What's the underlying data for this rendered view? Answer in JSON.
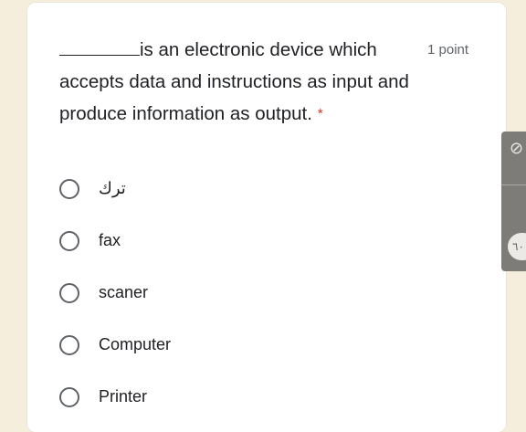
{
  "question": {
    "text_after_blank": "is an electronic device which accepts data and instructions as input and produce information as output.",
    "required_mark": "*",
    "points": "1 point"
  },
  "options": [
    {
      "label": "ترك",
      "selected": false
    },
    {
      "label": "fax",
      "selected": false
    },
    {
      "label": "scaner",
      "selected": false
    },
    {
      "label": "Computer",
      "selected": false
    },
    {
      "label": "Printer",
      "selected": false
    }
  ],
  "side_widget": {
    "top_icon": "mic-off-icon",
    "pill_text": "٦٠"
  }
}
